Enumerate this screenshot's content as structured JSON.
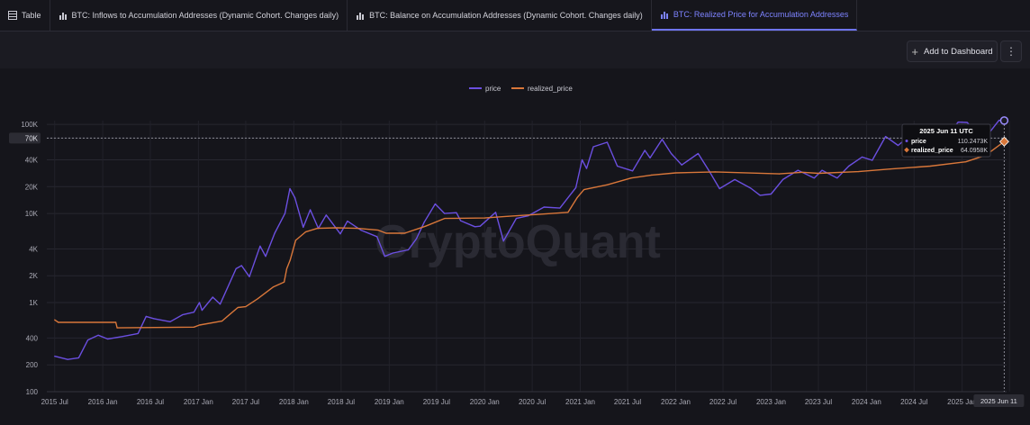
{
  "tabs": [
    {
      "label": "Table",
      "icon": "table-icon",
      "active": false
    },
    {
      "label": "BTC: Inflows to Accumulation Addresses (Dynamic Cohort. Changes daily)",
      "icon": "bar-chart-icon",
      "active": false
    },
    {
      "label": "BTC: Balance on Accumulation Addresses (Dynamic Cohort. Changes daily)",
      "icon": "bar-chart-icon",
      "active": false
    },
    {
      "label": "BTC: Realized Price for Accumulation Addresses",
      "icon": "bar-chart-icon",
      "active": true
    }
  ],
  "toolbar": {
    "add_dashboard_label": "Add to Dashboard",
    "more_icon": "vertical-dots-icon"
  },
  "watermark": "CryptoQuant",
  "colors": {
    "price": "#6b4fe0",
    "realized_price": "#d9773a",
    "accent": "#7d83ff",
    "background": "#15151b"
  },
  "tooltip": {
    "title": "2025 Jun 11 UTC",
    "rows": [
      {
        "name": "price",
        "value": "110.2473K"
      },
      {
        "name": "realized_price",
        "value": "64.0958K"
      }
    ]
  },
  "crosshair_x_label": "2025 Jun 11",
  "crosshair_y_label": "70K",
  "chart_data": {
    "type": "line",
    "legend": [
      "price",
      "realized_price"
    ],
    "legend_position": "top-center",
    "y_scale": "log",
    "ylim": [
      100,
      110000
    ],
    "y_ticks": [
      {
        "value": 100,
        "label": "100"
      },
      {
        "value": 200,
        "label": "200"
      },
      {
        "value": 400,
        "label": "400"
      },
      {
        "value": 1000,
        "label": "1K"
      },
      {
        "value": 2000,
        "label": "2K"
      },
      {
        "value": 4000,
        "label": "4K"
      },
      {
        "value": 10000,
        "label": "10K"
      },
      {
        "value": 20000,
        "label": "20K"
      },
      {
        "value": 40000,
        "label": "40K"
      },
      {
        "value": 70000,
        "label": "70K"
      },
      {
        "value": 100000,
        "label": "100K"
      }
    ],
    "xlim": [
      "2015-06-01",
      "2025-06-20"
    ],
    "x_ticks": [
      {
        "date": "2015-07-01",
        "label": "2015 Jul"
      },
      {
        "date": "2016-01-01",
        "label": "2016 Jan"
      },
      {
        "date": "2016-07-01",
        "label": "2016 Jul"
      },
      {
        "date": "2017-01-01",
        "label": "2017 Jan"
      },
      {
        "date": "2017-07-01",
        "label": "2017 Jul"
      },
      {
        "date": "2018-01-01",
        "label": "2018 Jan"
      },
      {
        "date": "2018-07-01",
        "label": "2018 Jul"
      },
      {
        "date": "2019-01-01",
        "label": "2019 Jan"
      },
      {
        "date": "2019-07-01",
        "label": "2019 Jul"
      },
      {
        "date": "2020-01-01",
        "label": "2020 Jan"
      },
      {
        "date": "2020-07-01",
        "label": "2020 Jul"
      },
      {
        "date": "2021-01-01",
        "label": "2021 Jan"
      },
      {
        "date": "2021-07-01",
        "label": "2021 Jul"
      },
      {
        "date": "2022-01-01",
        "label": "2022 Jan"
      },
      {
        "date": "2022-07-01",
        "label": "2022 Jul"
      },
      {
        "date": "2023-01-01",
        "label": "2023 Jan"
      },
      {
        "date": "2023-07-01",
        "label": "2023 Jul"
      },
      {
        "date": "2024-01-01",
        "label": "2024 Jan"
      },
      {
        "date": "2024-07-01",
        "label": "2024 Jul"
      },
      {
        "date": "2025-01-01",
        "label": "2025 Jan"
      },
      {
        "date": "2025-07-01",
        "label": "2025 Jul"
      }
    ],
    "grid": true,
    "series": [
      {
        "name": "price",
        "points": [
          [
            "2015-07-01",
            250
          ],
          [
            "2015-08-20",
            230
          ],
          [
            "2015-10-01",
            240
          ],
          [
            "2015-11-05",
            380
          ],
          [
            "2015-12-15",
            430
          ],
          [
            "2016-01-20",
            390
          ],
          [
            "2016-03-15",
            415
          ],
          [
            "2016-05-15",
            450
          ],
          [
            "2016-06-15",
            700
          ],
          [
            "2016-07-15",
            660
          ],
          [
            "2016-09-15",
            610
          ],
          [
            "2016-11-01",
            730
          ],
          [
            "2016-12-15",
            780
          ],
          [
            "2017-01-05",
            1000
          ],
          [
            "2017-01-15",
            820
          ],
          [
            "2017-02-25",
            1150
          ],
          [
            "2017-03-25",
            960
          ],
          [
            "2017-05-25",
            2400
          ],
          [
            "2017-06-15",
            2600
          ],
          [
            "2017-07-15",
            1950
          ],
          [
            "2017-08-25",
            4300
          ],
          [
            "2017-09-15",
            3300
          ],
          [
            "2017-10-20",
            6000
          ],
          [
            "2017-11-28",
            10000
          ],
          [
            "2017-12-17",
            19000
          ],
          [
            "2018-01-05",
            15000
          ],
          [
            "2018-02-06",
            7000
          ],
          [
            "2018-03-05",
            11000
          ],
          [
            "2018-04-05",
            6800
          ],
          [
            "2018-05-05",
            9600
          ],
          [
            "2018-06-28",
            5900
          ],
          [
            "2018-07-25",
            8200
          ],
          [
            "2018-09-15",
            6500
          ],
          [
            "2018-11-15",
            5500
          ],
          [
            "2018-12-15",
            3300
          ],
          [
            "2019-01-15",
            3600
          ],
          [
            "2019-03-15",
            3900
          ],
          [
            "2019-04-15",
            5200
          ],
          [
            "2019-05-15",
            8000
          ],
          [
            "2019-06-26",
            12800
          ],
          [
            "2019-08-01",
            10000
          ],
          [
            "2019-09-15",
            10200
          ],
          [
            "2019-10-01",
            8300
          ],
          [
            "2019-11-25",
            7100
          ],
          [
            "2019-12-15",
            7200
          ],
          [
            "2020-02-12",
            10300
          ],
          [
            "2020-03-13",
            4900
          ],
          [
            "2020-05-01",
            8800
          ],
          [
            "2020-06-15",
            9400
          ],
          [
            "2020-08-15",
            11800
          ],
          [
            "2020-10-15",
            11500
          ],
          [
            "2020-12-15",
            19500
          ],
          [
            "2021-01-08",
            40000
          ],
          [
            "2021-01-25",
            32000
          ],
          [
            "2021-02-20",
            56000
          ],
          [
            "2021-04-14",
            63000
          ],
          [
            "2021-05-23",
            34000
          ],
          [
            "2021-07-20",
            30000
          ],
          [
            "2021-09-05",
            51000
          ],
          [
            "2021-09-25",
            42000
          ],
          [
            "2021-11-10",
            68000
          ],
          [
            "2021-12-15",
            47000
          ],
          [
            "2022-01-24",
            35000
          ],
          [
            "2022-03-28",
            47000
          ],
          [
            "2022-05-12",
            29000
          ],
          [
            "2022-06-18",
            19000
          ],
          [
            "2022-08-15",
            24000
          ],
          [
            "2022-10-15",
            19200
          ],
          [
            "2022-11-20",
            16000
          ],
          [
            "2023-01-01",
            16500
          ],
          [
            "2023-02-15",
            24000
          ],
          [
            "2023-04-14",
            30500
          ],
          [
            "2023-06-15",
            25000
          ],
          [
            "2023-07-15",
            30500
          ],
          [
            "2023-09-11",
            25000
          ],
          [
            "2023-10-25",
            34000
          ],
          [
            "2023-12-15",
            43000
          ],
          [
            "2024-01-23",
            39500
          ],
          [
            "2024-03-14",
            73000
          ],
          [
            "2024-05-01",
            58000
          ],
          [
            "2024-06-05",
            71000
          ],
          [
            "2024-08-05",
            54000
          ],
          [
            "2024-09-06",
            53000
          ],
          [
            "2024-10-29",
            72000
          ],
          [
            "2024-12-17",
            106000
          ],
          [
            "2025-01-20",
            105000
          ],
          [
            "2025-02-28",
            80000
          ],
          [
            "2025-04-08",
            76000
          ],
          [
            "2025-05-22",
            111000
          ],
          [
            "2025-06-11",
            110247
          ]
        ]
      },
      {
        "name": "realized_price",
        "points": [
          [
            "2015-07-01",
            640
          ],
          [
            "2015-07-15",
            600
          ],
          [
            "2016-02-20",
            600
          ],
          [
            "2016-02-25",
            520
          ],
          [
            "2016-12-15",
            530
          ],
          [
            "2017-01-05",
            560
          ],
          [
            "2017-04-01",
            620
          ],
          [
            "2017-06-01",
            880
          ],
          [
            "2017-07-01",
            900
          ],
          [
            "2017-08-15",
            1100
          ],
          [
            "2017-10-15",
            1500
          ],
          [
            "2017-11-25",
            1700
          ],
          [
            "2017-12-05",
            2400
          ],
          [
            "2017-12-18",
            3000
          ],
          [
            "2018-01-08",
            5000
          ],
          [
            "2018-02-15",
            6200
          ],
          [
            "2018-04-01",
            6800
          ],
          [
            "2018-06-15",
            6900
          ],
          [
            "2018-09-01",
            6800
          ],
          [
            "2018-11-20",
            6500
          ],
          [
            "2018-12-20",
            6000
          ],
          [
            "2019-03-01",
            6000
          ],
          [
            "2019-05-20",
            7200
          ],
          [
            "2019-08-01",
            8800
          ],
          [
            "2020-01-01",
            8900
          ],
          [
            "2020-04-01",
            9300
          ],
          [
            "2020-08-01",
            9800
          ],
          [
            "2020-11-15",
            10300
          ],
          [
            "2020-12-20",
            15000
          ],
          [
            "2021-01-15",
            18500
          ],
          [
            "2021-04-15",
            21000
          ],
          [
            "2021-07-15",
            25000
          ],
          [
            "2021-10-01",
            27000
          ],
          [
            "2022-01-01",
            28500
          ],
          [
            "2022-06-01",
            29300
          ],
          [
            "2023-02-01",
            27800
          ],
          [
            "2023-05-01",
            29000
          ],
          [
            "2023-07-01",
            28200
          ],
          [
            "2023-12-01",
            29500
          ],
          [
            "2024-04-01",
            31500
          ],
          [
            "2024-09-01",
            34000
          ],
          [
            "2025-01-15",
            38000
          ],
          [
            "2025-04-01",
            45000
          ],
          [
            "2025-06-11",
            64096
          ]
        ]
      }
    ]
  }
}
